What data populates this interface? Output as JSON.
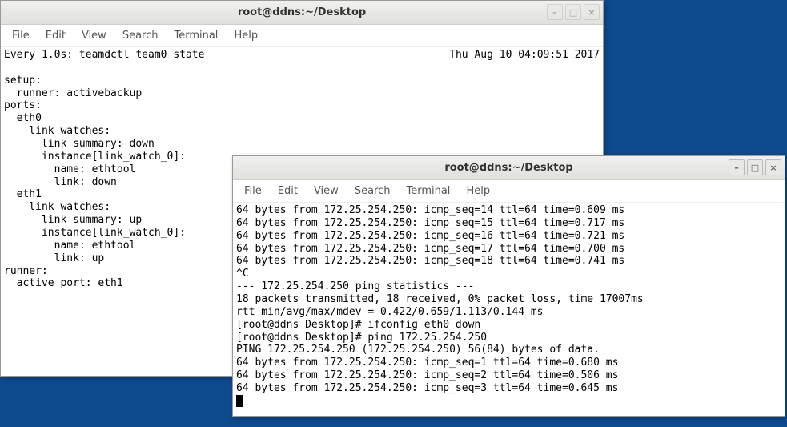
{
  "window1": {
    "title": "root@ddns:~/Desktop",
    "menu": [
      "File",
      "Edit",
      "View",
      "Search",
      "Terminal",
      "Help"
    ],
    "watch_left": "Every 1.0s: teamdctl team0 state",
    "watch_right": "Thu Aug 10 04:09:51 2017",
    "body": "setup:\n  runner: activebackup\nports:\n  eth0\n    link watches:\n      link summary: down\n      instance[link_watch_0]:\n        name: ethtool\n        link: down\n  eth1\n    link watches:\n      link summary: up\n      instance[link_watch_0]:\n        name: ethtool\n        link: up\nrunner:\n  active port: eth1"
  },
  "window2": {
    "title": "root@ddns:~/Desktop",
    "menu": [
      "File",
      "Edit",
      "View",
      "Search",
      "Terminal",
      "Help"
    ],
    "body": "64 bytes from 172.25.254.250: icmp_seq=14 ttl=64 time=0.609 ms\n64 bytes from 172.25.254.250: icmp_seq=15 ttl=64 time=0.717 ms\n64 bytes from 172.25.254.250: icmp_seq=16 ttl=64 time=0.721 ms\n64 bytes from 172.25.254.250: icmp_seq=17 ttl=64 time=0.700 ms\n64 bytes from 172.25.254.250: icmp_seq=18 ttl=64 time=0.741 ms\n^C\n--- 172.25.254.250 ping statistics ---\n18 packets transmitted, 18 received, 0% packet loss, time 17007ms\nrtt min/avg/max/mdev = 0.422/0.659/1.113/0.144 ms\n[root@ddns Desktop]# ifconfig eth0 down\n[root@ddns Desktop]# ping 172.25.254.250\nPING 172.25.254.250 (172.25.254.250) 56(84) bytes of data.\n64 bytes from 172.25.254.250: icmp_seq=1 ttl=64 time=0.680 ms\n64 bytes from 172.25.254.250: icmp_seq=2 ttl=64 time=0.506 ms\n64 bytes from 172.25.254.250: icmp_seq=3 ttl=64 time=0.645 ms"
  },
  "controls": {
    "minimize": "–",
    "maximize": "□",
    "close": "×"
  }
}
